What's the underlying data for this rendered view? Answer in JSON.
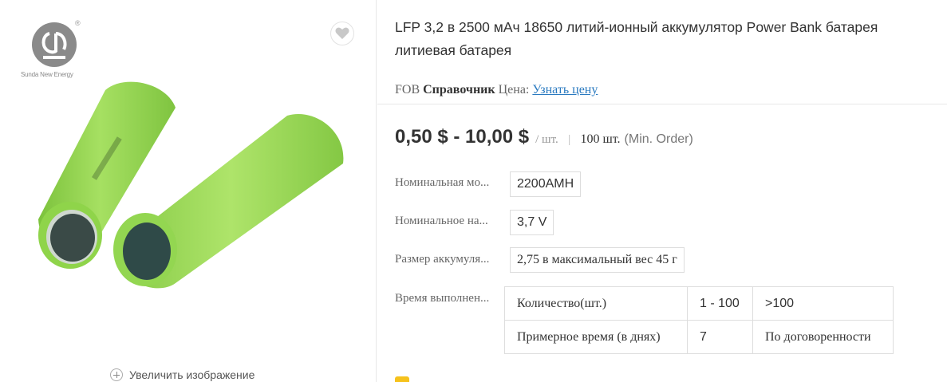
{
  "brand": {
    "logo_text": "Sunda New Energy",
    "reg_mark": "®"
  },
  "gallery": {
    "favorite_icon": "heart-icon",
    "zoom_label": "Увеличить изображение",
    "zoom_icon": "plus-circle-icon"
  },
  "product": {
    "title": "LFP 3,2 в 2500 мАч 18650 литий-ионный аккумулятор Power Bank батарея литиевая батарея"
  },
  "fob": {
    "prefix": "FOB",
    "bold": "Справочник",
    "price_label": "Цена:",
    "link_text": "Узнать цену"
  },
  "price": {
    "range": "0,50 $ - 10,00 $",
    "unit": "/ шт.",
    "separator": "|",
    "min_qty": "100 шт.",
    "min_order_label": "(Min. Order)"
  },
  "attributes": [
    {
      "label": "Номинальная мо...",
      "value": "2200AMH"
    },
    {
      "label": "Номинальное на...",
      "value": "3,7 V"
    },
    {
      "label": "Размер аккумуля...",
      "value": "2,75 в максимальный вес 45 г"
    }
  ],
  "lead_time": {
    "label": "Время выполнен...",
    "header": [
      "Количество(шт.)",
      "1 - 100",
      ">100"
    ],
    "row": [
      "Примерное время (в днях)",
      "7",
      "По договоренности"
    ]
  },
  "colors": {
    "link": "#2a7ac0",
    "battery_green": "#8fd44a",
    "battery_cap": "#2f4a48"
  }
}
